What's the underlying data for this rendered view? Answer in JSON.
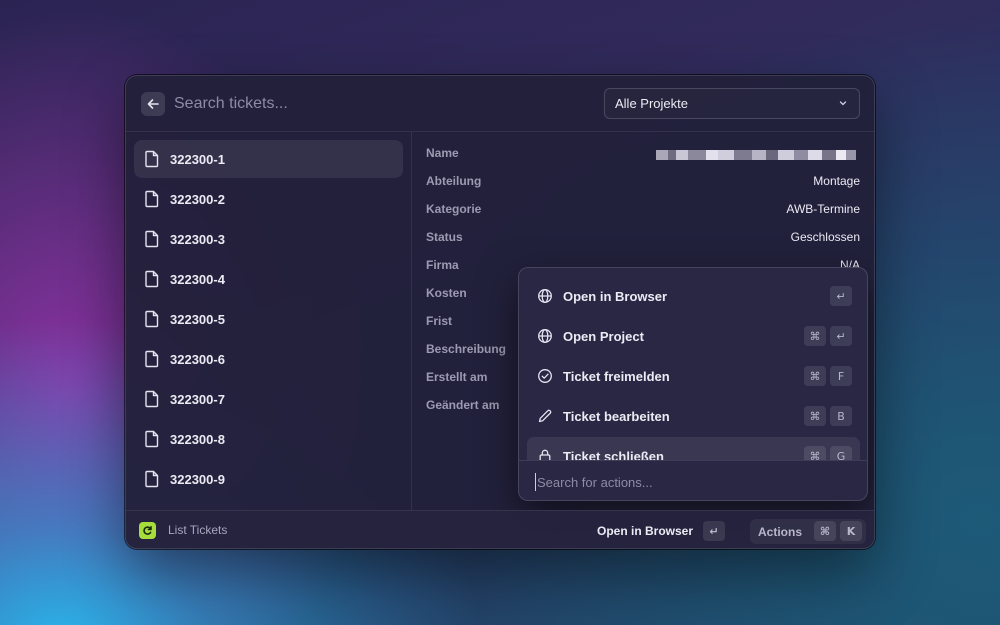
{
  "header": {
    "search_placeholder": "Search tickets...",
    "project_select": "Alle Projekte"
  },
  "tickets": [
    {
      "label": "322300-1"
    },
    {
      "label": "322300-2"
    },
    {
      "label": "322300-3"
    },
    {
      "label": "322300-4"
    },
    {
      "label": "322300-5"
    },
    {
      "label": "322300-6"
    },
    {
      "label": "322300-7"
    },
    {
      "label": "322300-8"
    },
    {
      "label": "322300-9"
    }
  ],
  "details": [
    {
      "key": "Name",
      "value": ""
    },
    {
      "key": "Abteilung",
      "value": "Montage"
    },
    {
      "key": "Kategorie",
      "value": "AWB-Termine"
    },
    {
      "key": "Status",
      "value": "Geschlossen"
    },
    {
      "key": "Firma",
      "value": "N/A"
    },
    {
      "key": "Kosten",
      "value": ""
    },
    {
      "key": "Frist",
      "value": ""
    },
    {
      "key": "Beschreibung",
      "value": ""
    },
    {
      "key": "Erstellt am",
      "value": ""
    },
    {
      "key": "Geändert am",
      "value": ""
    }
  ],
  "actions": [
    {
      "label": "Open in Browser",
      "icon": "globe-icon",
      "keys": [
        "↵"
      ]
    },
    {
      "label": "Open Project",
      "icon": "globe-icon",
      "keys": [
        "⌘",
        "↵"
      ]
    },
    {
      "label": "Ticket freimelden",
      "icon": "check-circle-icon",
      "keys": [
        "⌘",
        "F"
      ]
    },
    {
      "label": "Ticket bearbeiten",
      "icon": "pencil-icon",
      "keys": [
        "⌘",
        "B"
      ]
    },
    {
      "label": "Ticket schließen",
      "icon": "lock-icon",
      "keys": [
        "⌘",
        "G"
      ]
    }
  ],
  "action_search_placeholder": "Search for actions...",
  "footer": {
    "title": "List Tickets",
    "primary_action": "Open in Browser",
    "primary_key": "↵",
    "actions_label": "Actions",
    "actions_keys": [
      "⌘",
      "K"
    ]
  },
  "colors": {
    "app_icon": "#a6dc3c",
    "window_bg": "#22203a",
    "selection": "#34324f"
  }
}
